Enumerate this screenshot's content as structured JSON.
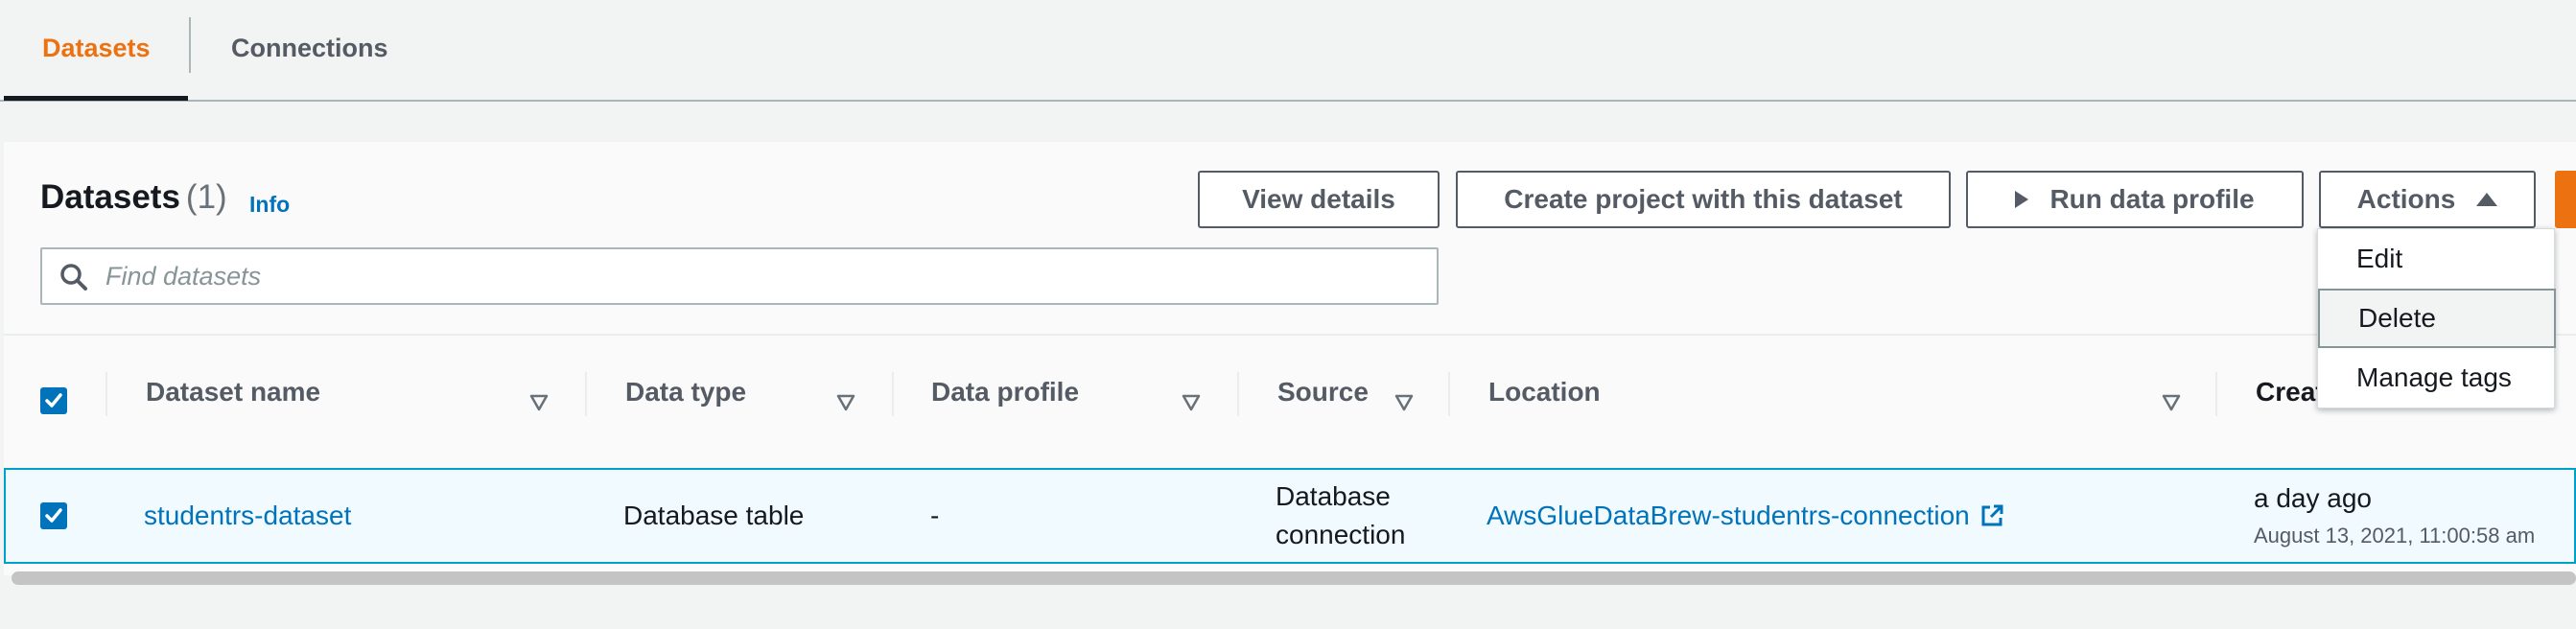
{
  "tabs": [
    {
      "label": "Datasets",
      "active": true
    },
    {
      "label": "Connections",
      "active": false
    }
  ],
  "panel": {
    "title": "Datasets",
    "count": "(1)",
    "info_label": "Info"
  },
  "buttons": {
    "view_details": "View details",
    "create_project": "Create project with this dataset",
    "run_profile": "Run data profile",
    "actions": "Actions"
  },
  "search": {
    "placeholder": "Find datasets",
    "value": ""
  },
  "table": {
    "columns": [
      "Dataset name",
      "Data type",
      "Data profile",
      "Source",
      "Location",
      "Create date"
    ],
    "row": {
      "selected": true,
      "dataset_name": "studentrs-dataset",
      "data_type": "Database table",
      "data_profile": "-",
      "source_line1": "Database",
      "source_line2": "connection",
      "location": "AwsGlueDataBrew-studentrs-connection",
      "create_relative": "a day ago",
      "create_absolute": "August 13, 2021, 11:00:58 am"
    }
  },
  "actions_menu": {
    "items": [
      "Edit",
      "Delete",
      "Manage tags"
    ],
    "highlighted": "Delete"
  },
  "colors": {
    "accent": "#ec7211",
    "link": "#0073bb",
    "selected_row_bg": "#f1faff",
    "selected_row_border": "#00a1c9"
  }
}
